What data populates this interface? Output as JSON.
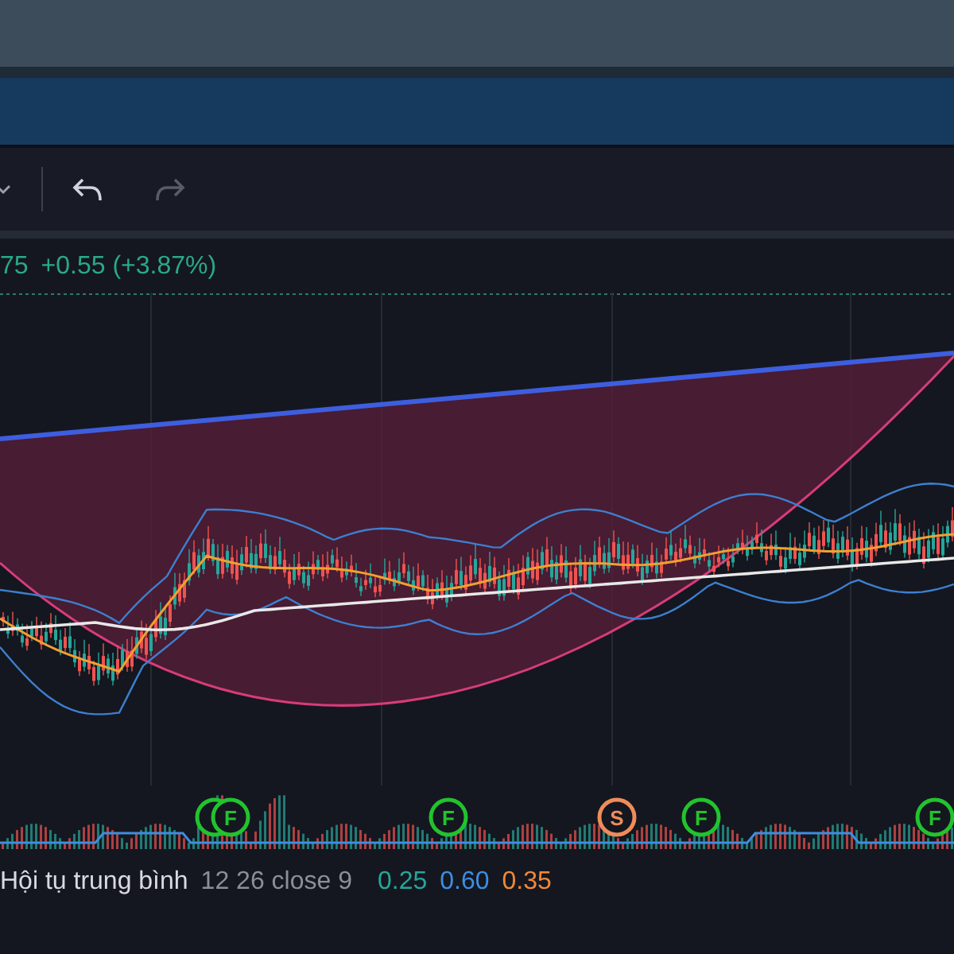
{
  "toolbar": {
    "undo": {
      "disabled": false
    },
    "redo": {
      "disabled": true
    }
  },
  "price": {
    "last": "75",
    "change": "+0.55 (+3.87%)"
  },
  "signals": [
    {
      "label": "F",
      "color": "#22c32e",
      "doubled": true
    },
    {
      "label": "F",
      "color": "#22c32e",
      "doubled": false
    },
    {
      "label": "S",
      "color": "#f08c5a",
      "doubled": false
    },
    {
      "label": "F",
      "color": "#22c32e",
      "doubled": false
    },
    {
      "label": "F",
      "color": "#22c32e",
      "doubled": false
    }
  ],
  "indicator": {
    "name": "Hội tụ trung bình",
    "params": "12 26 close 9",
    "values": [
      {
        "text": "0.25",
        "color": "#26a69a"
      },
      {
        "text": "0.60",
        "color": "#3d8ee0"
      },
      {
        "text": "0.35",
        "color": "#f0883a"
      }
    ]
  }
}
